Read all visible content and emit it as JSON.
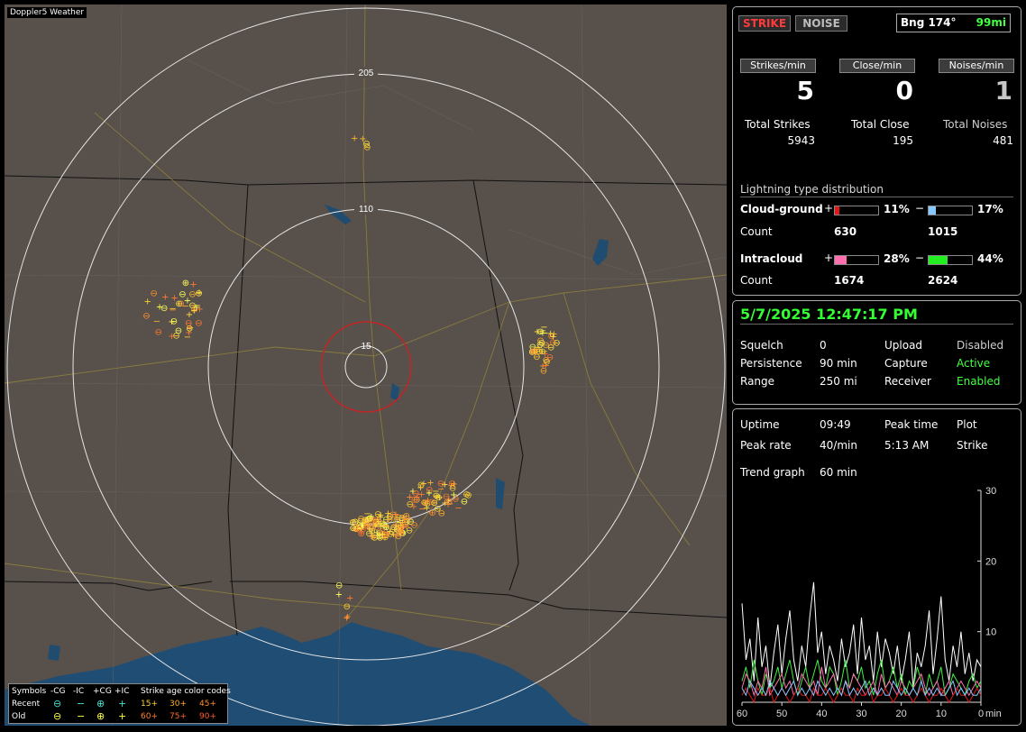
{
  "app": {
    "title": "Doppler5 Weather"
  },
  "map": {
    "range_labels": [
      "205",
      "110",
      "15"
    ]
  },
  "legend": {
    "symbols_label": "Symbols",
    "col_neg_cg": "-CG",
    "col_neg_ic": "-IC",
    "col_pos_cg": "+CG",
    "col_pos_ic": "+IC",
    "recent_label": "Recent",
    "old_label": "Old",
    "age_title": "Strike age color codes",
    "ages_row1": [
      "15+",
      "30+",
      "45+"
    ],
    "ages_row2": [
      "60+",
      "75+",
      "90+"
    ]
  },
  "status": {
    "strike_button": "STRIKE",
    "noise_button": "NOISE",
    "bearing_label": "Bng 174°",
    "distance_label": "99mi"
  },
  "rates": {
    "strikes_per_min_label": "Strikes/min",
    "close_per_min_label": "Close/min",
    "noises_per_min_label": "Noises/min",
    "strikes_per_min": "5",
    "close_per_min": "0",
    "noises_per_min": "1"
  },
  "totals": {
    "total_strikes_label": "Total Strikes",
    "total_close_label": "Total Close",
    "total_noises_label": "Total Noises",
    "total_strikes": "5943",
    "total_close": "195",
    "total_noises": "481"
  },
  "distribution": {
    "title": "Lightning type distribution",
    "cg_label": "Cloud-ground",
    "ic_label": "Intracloud",
    "plus_sign": "+",
    "minus_sign": "−",
    "count_label": "Count",
    "cg_pos_pct": "11%",
    "cg_neg_pct": "17%",
    "ic_pos_pct": "28%",
    "ic_neg_pct": "44%",
    "cg_pos_fraction": 0.11,
    "cg_neg_fraction": 0.17,
    "ic_pos_fraction": 0.28,
    "ic_neg_fraction": 0.44,
    "cg_pos_count": "630",
    "cg_neg_count": "1015",
    "ic_pos_count": "1674",
    "ic_neg_count": "2624",
    "colors": {
      "cg_pos": "#e01818",
      "cg_neg": "#88c8ff",
      "ic_pos": "#ff6fb0",
      "ic_neg": "#22ee22"
    }
  },
  "datetime": "5/7/2025 12:47:17 PM",
  "settings": {
    "squelch_label": "Squelch",
    "squelch_value": "0",
    "persistence_label": "Persistence",
    "persistence_value": "90 min",
    "range_label": "Range",
    "range_value": "250 mi",
    "upload_label": "Upload",
    "upload_value": "Disabled",
    "capture_label": "Capture",
    "capture_value": "Active",
    "receiver_label": "Receiver",
    "receiver_value": "Enabled"
  },
  "stats": {
    "uptime_label": "Uptime",
    "uptime_value": "09:49",
    "peak_time_label": "Peak time",
    "peak_time_value": "5:13 AM",
    "peak_rate_label": "Peak rate",
    "peak_rate_value": "40/min",
    "plot_label": "Plot",
    "plot_value": "Strike",
    "trend_label": "Trend graph",
    "trend_value": "60 min"
  },
  "chart_data": {
    "type": "line",
    "x": [
      60,
      59,
      58,
      57,
      56,
      55,
      54,
      53,
      52,
      51,
      50,
      49,
      48,
      47,
      46,
      45,
      44,
      43,
      42,
      41,
      40,
      39,
      38,
      37,
      36,
      35,
      34,
      33,
      32,
      31,
      30,
      29,
      28,
      27,
      26,
      25,
      24,
      23,
      22,
      21,
      20,
      19,
      18,
      17,
      16,
      15,
      14,
      13,
      12,
      11,
      10,
      9,
      8,
      7,
      6,
      5,
      4,
      3,
      2,
      1,
      0
    ],
    "xlim": [
      60,
      0
    ],
    "ylim": [
      0,
      30
    ],
    "x_ticks": [
      "60",
      "50",
      "40",
      "30",
      "20",
      "10",
      "0"
    ],
    "y_ticks": [
      "30",
      "20",
      "10"
    ],
    "x_unit": "min",
    "series": [
      {
        "color": "#ffffff",
        "values": [
          14,
          6,
          9,
          3,
          12,
          5,
          8,
          2,
          7,
          11,
          4,
          9,
          13,
          6,
          3,
          8,
          5,
          12,
          17,
          7,
          10,
          4,
          8,
          6,
          3,
          9,
          5,
          7,
          11,
          4,
          12,
          6,
          8,
          3,
          10,
          5,
          9,
          7,
          4,
          8,
          3,
          6,
          10,
          2,
          7,
          5,
          8,
          13,
          4,
          9,
          15,
          6,
          3,
          8,
          5,
          10,
          4,
          7,
          3,
          6,
          5
        ]
      },
      {
        "color": "#44ee44",
        "values": [
          3,
          5,
          2,
          6,
          3,
          1,
          4,
          2,
          3,
          5,
          2,
          4,
          6,
          3,
          1,
          3,
          5,
          2,
          4,
          6,
          3,
          2,
          5,
          4,
          1,
          3,
          6,
          2,
          4,
          3,
          5,
          2,
          3,
          1,
          4,
          6,
          2,
          3,
          5,
          2,
          4,
          1,
          3,
          2,
          5,
          3,
          1,
          4,
          2,
          3,
          5,
          1,
          2,
          4,
          3,
          2,
          1,
          3,
          4,
          2,
          3
        ]
      },
      {
        "color": "#ff6fb0",
        "values": [
          2,
          4,
          3,
          1,
          3,
          2,
          5,
          1,
          2,
          3,
          4,
          2,
          3,
          1,
          2,
          4,
          3,
          2,
          3,
          1,
          5,
          2,
          3,
          4,
          2,
          1,
          3,
          2,
          4,
          3,
          2,
          1,
          2,
          3,
          1,
          4,
          2,
          3,
          2,
          1,
          3,
          2,
          1,
          2,
          3,
          4,
          2,
          1,
          2,
          3,
          1,
          2,
          3,
          1,
          2,
          3,
          2,
          1,
          2,
          3,
          2
        ]
      },
      {
        "color": "#e01818",
        "values": [
          1,
          2,
          1,
          0,
          2,
          1,
          1,
          2,
          0,
          1,
          2,
          1,
          0,
          1,
          2,
          1,
          1,
          0,
          2,
          1,
          1,
          2,
          1,
          0,
          1,
          2,
          1,
          1,
          0,
          2,
          1,
          1,
          2,
          0,
          1,
          1,
          2,
          1,
          0,
          1,
          2,
          1,
          1,
          0,
          1,
          2,
          1,
          0,
          1,
          1,
          2,
          1,
          0,
          1,
          2,
          1,
          1,
          0,
          1,
          2,
          1
        ]
      },
      {
        "color": "#88c8ff",
        "values": [
          2,
          1,
          3,
          2,
          1,
          2,
          1,
          3,
          2,
          1,
          2,
          1,
          2,
          3,
          1,
          2,
          1,
          2,
          1,
          3,
          2,
          1,
          2,
          1,
          2,
          1,
          3,
          1,
          2,
          1,
          2,
          3,
          1,
          2,
          1,
          2,
          1,
          1,
          3,
          2,
          1,
          2,
          1,
          2,
          1,
          3,
          1,
          2,
          1,
          2,
          1,
          1,
          2,
          3,
          1,
          2,
          1,
          2,
          1,
          1,
          2
        ]
      }
    ]
  }
}
